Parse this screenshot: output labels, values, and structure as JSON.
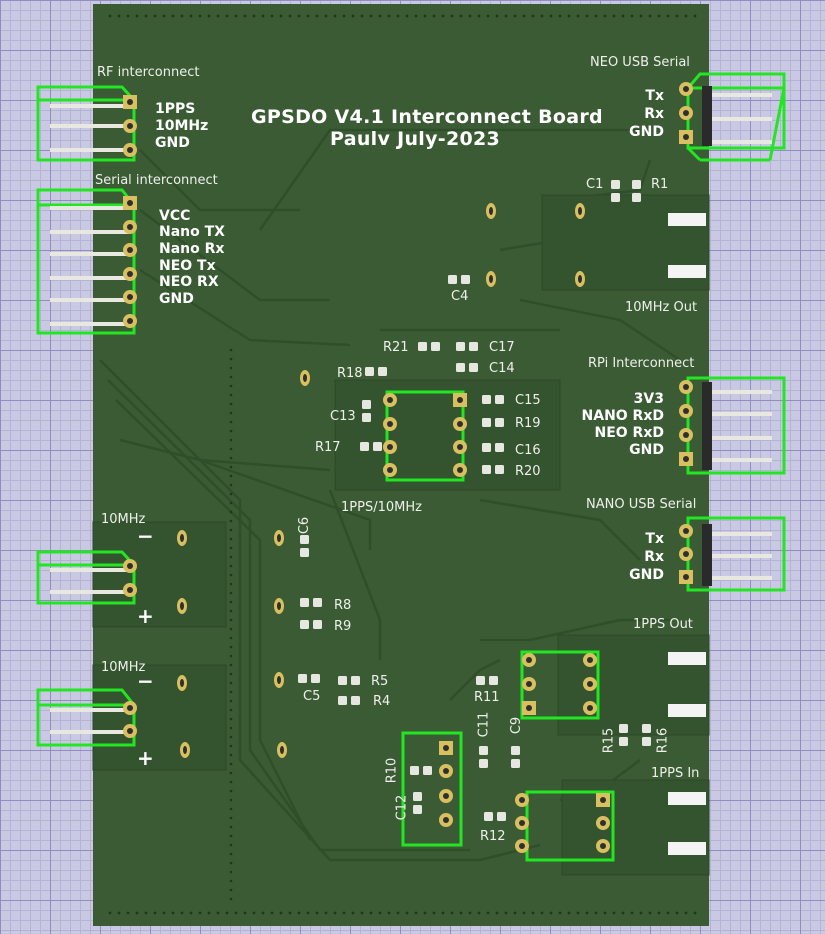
{
  "board": {
    "title": "GPSDO V4.1 Interconnect Board",
    "author_line": "Paulv July-2023"
  },
  "sections": {
    "rf_interconnect": "RF interconnect",
    "serial_interconnect": "Serial interconnect",
    "neo_usb_serial": "NEO USB Serial",
    "rpi_interconnect": "RPi Interconnect",
    "nano_usb_serial": "NANO USB Serial",
    "out_10mhz": "10MHz Out",
    "pps_10mhz": "1PPS/10MHz",
    "in_10mhz_a": "10MHz",
    "in_10mhz_b": "10MHz",
    "pps_out": "1PPS Out",
    "pps_in": "1PPS In"
  },
  "pins": {
    "rf": [
      "1PPS",
      "10MHz",
      "GND"
    ],
    "serial": [
      "VCC",
      "Nano TX",
      "Nano Rx",
      "NEO Tx",
      "NEO RX",
      "GND"
    ],
    "neo_usb": [
      "Tx",
      "Rx",
      "GND"
    ],
    "rpi": [
      "3V3",
      "NANO RxD",
      "NEO RxD",
      "GND"
    ],
    "nano_usb": [
      "Tx",
      "Rx",
      "GND"
    ]
  },
  "power_symbols": {
    "minus": "−",
    "plus": "+"
  },
  "refdes": {
    "C1": "C1",
    "R1": "R1",
    "C4": "C4",
    "R21": "R21",
    "C17": "C17",
    "R18": "R18",
    "C14": "C14",
    "C13": "C13",
    "C15": "C15",
    "R19": "R19",
    "R17": "R17",
    "C16": "C16",
    "R20": "R20",
    "C6": "C6",
    "R8": "R8",
    "R9": "R9",
    "C5": "C5",
    "R5": "R5",
    "R4": "R4",
    "R11": "R11",
    "C11": "C11",
    "C9": "C9",
    "R15": "R15",
    "R16": "R16",
    "R10": "R10",
    "C12": "C12",
    "R12": "R12"
  },
  "colors": {
    "board": "#3b5b35",
    "silkscreen": "#f2f2ee",
    "connector_outline": "#22e622",
    "pad": "#d8c060",
    "trace": "#355530",
    "background_grid": "#c9c9e3"
  }
}
